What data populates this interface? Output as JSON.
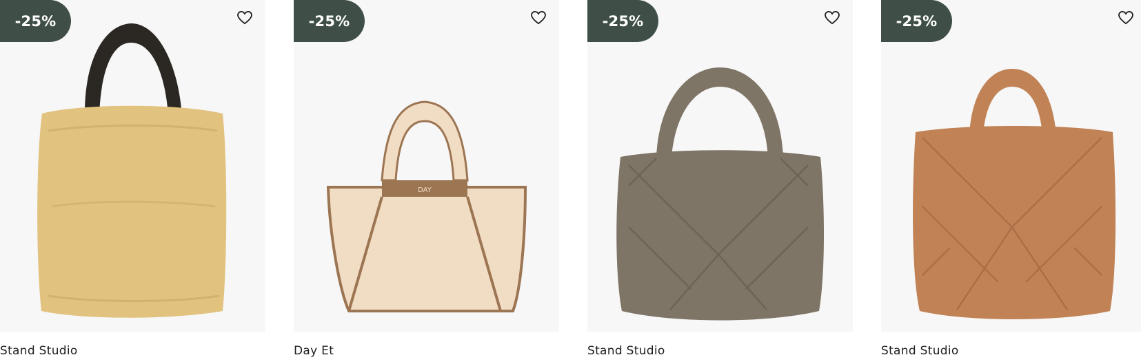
{
  "products": [
    {
      "brand": "Stand Studio",
      "discount": "-25%",
      "image_icon": "fur-tote-bag-image",
      "colors": {
        "body": "#e2c27f",
        "handle": "#2b2722"
      }
    },
    {
      "brand": "Day Et",
      "discount": "-25%",
      "image_icon": "shearling-tote-bag-image",
      "logo": "DAY",
      "colors": {
        "body": "#f1dcc4",
        "trim": "#9c7552"
      }
    },
    {
      "brand": "Stand Studio",
      "discount": "-25%",
      "image_icon": "quilted-tote-bag-image",
      "colors": {
        "body": "#7f7566"
      }
    },
    {
      "brand": "Stand Studio",
      "discount": "-25%",
      "image_icon": "quilted-tote-bag-image",
      "colors": {
        "body": "#c18356"
      }
    }
  ],
  "theme": {
    "badge_bg": "#3f4f47",
    "badge_text": "#ffffff",
    "card_bg": "#f7f7f8"
  }
}
